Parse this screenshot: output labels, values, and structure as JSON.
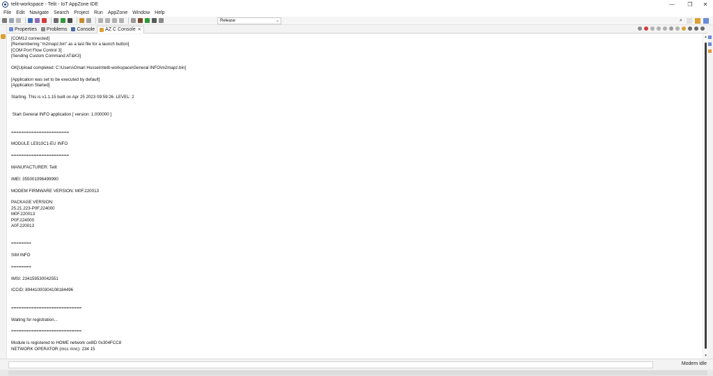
{
  "window": {
    "title": "telit-workspace - Telit - IoT AppZone IDE",
    "minimize": "—",
    "restore": "❐",
    "close": "✕"
  },
  "menu": [
    "File",
    "Edit",
    "Navigate",
    "Search",
    "Project",
    "Run",
    "AppZone",
    "Window",
    "Help"
  ],
  "toolbar": {
    "run_config": "Release"
  },
  "tabs": [
    {
      "label": "Properties",
      "icon": "properties-icon",
      "color": "#6a8bd6"
    },
    {
      "label": "Problems",
      "icon": "problems-icon",
      "color": "#8a8a8a"
    },
    {
      "label": "Console",
      "icon": "console-icon",
      "color": "#4b6ea9"
    },
    {
      "label": "AZ C Console",
      "icon": "az-console-icon",
      "color": "#d9a032",
      "active": true,
      "close": "✕"
    }
  ],
  "console_lines": [
    "[COM12 connected]",
    "[Remembering \"m2mapz.bin\" as a last file for a launch button]",
    "[COM Port Flow Control 3]",
    "[Sending Custom Command AT&K3]",
    "",
    "OK[Upload completed: C:\\Users\\Omari Hussein\\telit-workspace\\General INFO\\m2mapz.bin]",
    "",
    "[Application was set to be executed by default]",
    "[Application Started]",
    "",
    "Starting. This is v1.1.15 built on Apr 25 2023 09:59:26. LEVEL: 2",
    "",
    "",
    " Start General INFO application [ version: 1.000000 ]",
    "",
    "",
    "=======================",
    "",
    "MODULE LE910C1-EU INFO",
    "",
    "=======================",
    "",
    "MANUFACTURER: Telit",
    "",
    "IMEI: 355001096499990",
    "",
    "MODEM FIRMWARE VERSION: M0F.220013",
    "",
    "PACKAGE VERSION:",
    "25.21.223-P0F.224000",
    "M0F.220013",
    "P0F.224000",
    "A0F.220013",
    "",
    "",
    "========",
    "",
    "SIM INFO",
    "",
    "========",
    "",
    "IMSI: 234159530042551",
    "",
    "ICCID: 89441000304108184496",
    "",
    "",
    "============================",
    "",
    "Waiting for registration...",
    "",
    "============================",
    "",
    "Module is registered to HOME network cellID 0x304FCC8",
    "NETWORK OPERATOR (mcc mnc): 234 15"
  ],
  "status": {
    "text": "Modem idle"
  }
}
